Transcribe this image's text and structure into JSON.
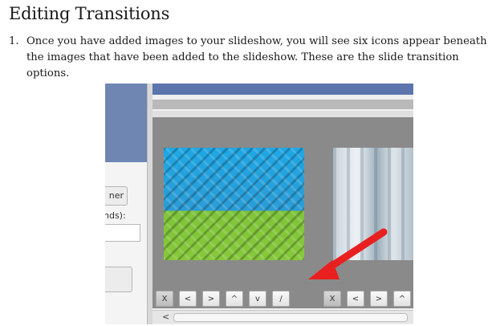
{
  "heading": "Editing Transitions",
  "step": {
    "number": "1.",
    "text": "Once you have added images to your slideshow, you will see six icons appear beneath the images that have been added to the slideshow. These are the slide transition options."
  },
  "screenshot": {
    "left_button_fragment": "ner",
    "left_label_fragment": "nds):",
    "toolbar1": [
      "X",
      "<",
      ">",
      "^",
      "v",
      "/"
    ],
    "toolbar2": [
      "X",
      "<",
      ">",
      "^"
    ],
    "scroll_left_arrow": "<",
    "arrow_color": "#e82020"
  }
}
